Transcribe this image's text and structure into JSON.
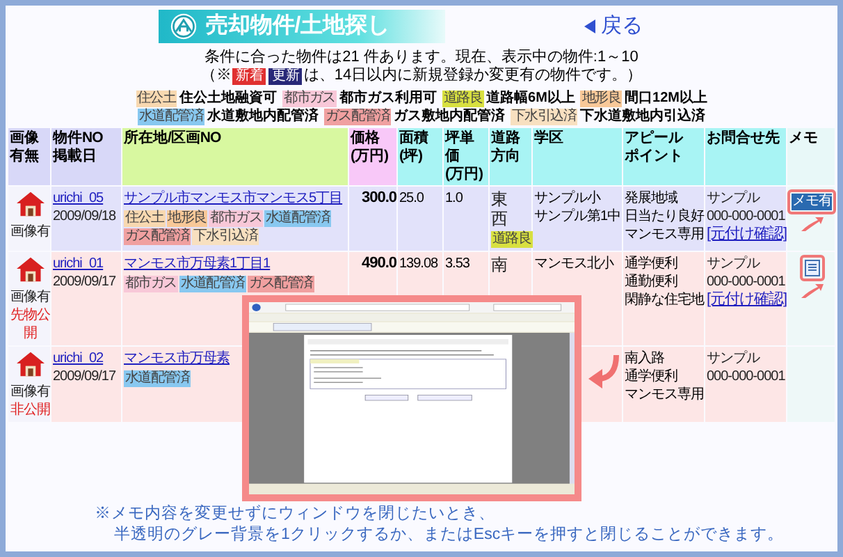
{
  "header": {
    "title": "売却物件/土地探し",
    "back_link": "戻る"
  },
  "summary": {
    "line_1": "条件に合った物件は21 件あります。現在、表示中の物件:1～10",
    "line_2_prefix": "（※",
    "badges": [
      {
        "label": "新着",
        "color": "#e03030"
      },
      {
        "label": "更新",
        "color": "#282878"
      }
    ],
    "line_2_suffix": "は、14日以内に新規登録か変更有の物件です。）"
  },
  "legend": [
    [
      {
        "tag": "住公土",
        "color": "#f8d8b0",
        "meaning": "住公土地融資可"
      },
      {
        "tag": "都市ガス",
        "color": "#f8c8d8",
        "meaning": "都市ガス利用可"
      },
      {
        "tag": "道路良",
        "color": "#d8e040",
        "meaning": "道路幅6M以上"
      },
      {
        "tag": "地形良",
        "color": "#f8c898",
        "meaning": "間口12M以上"
      }
    ],
    [
      {
        "tag": "水道配管済",
        "color": "#88c8f0",
        "meaning": "水道敷地内配管済"
      },
      {
        "tag": "ガス配管済",
        "color": "#f0a0a0",
        "meaning": "ガス敷地内配管済"
      },
      {
        "tag": "下水引込済",
        "color": "#f8e0c0",
        "meaning": "下水道敷地内引込済"
      }
    ]
  ],
  "table": {
    "columns": [
      [
        "画像",
        "有無"
      ],
      [
        "物件NO",
        "掲載日"
      ],
      [
        "所在地/区画NO"
      ],
      [
        "価格",
        "(万円)"
      ],
      [
        "面積",
        "(坪)"
      ],
      [
        "坪単価",
        "(万円)"
      ],
      [
        "道路",
        "方向"
      ],
      [
        "学区"
      ],
      [
        "アピール",
        "ポイント"
      ],
      [
        "お問合せ先"
      ],
      [
        "メモ"
      ]
    ],
    "rows": [
      {
        "image_label": "画像有",
        "id": "urichi_05",
        "date": "2009/09/18",
        "address": "サンプル市マンモス市マンモス5丁目",
        "tags": [
          {
            "label": "住公土",
            "color": "#f8d8b0"
          },
          {
            "label": "地形良",
            "color": "#f8c898"
          },
          {
            "label": "都市ガス",
            "color": "#f8c8d8"
          },
          {
            "label": "水道配管済",
            "color": "#88c8f0"
          },
          {
            "label": "ガス配管済",
            "color": "#f0a0a0"
          },
          {
            "label": "下水引込済",
            "color": "#f8e0c0"
          }
        ],
        "price": "300.0",
        "area": "25.0",
        "unit_price": "1.0",
        "road": [
          "東",
          "西"
        ],
        "road_tags": [
          {
            "label": "道路良",
            "color": "#d8e040"
          }
        ],
        "school": [
          "サンプル小",
          "サンプル第1中"
        ],
        "appeal": [
          "発展地域",
          "日当たり良好",
          "マンモス専用"
        ],
        "contact": [
          "サンプル",
          "000-000-0001"
        ],
        "contact_link": "[元付け確認]",
        "memo": {
          "kind": "badge",
          "label": "メモ有",
          "highlighted": true
        }
      },
      {
        "image_label": "画像有",
        "status": "先物公開",
        "id": "urichi_01",
        "date": "2009/09/17",
        "address": "マンモス市万母素1丁目1",
        "tags": [
          {
            "label": "都市ガス",
            "color": "#f8c8d8"
          },
          {
            "label": "水道配管済",
            "color": "#88c8f0"
          },
          {
            "label": "ガス配管済",
            "color": "#f0a0a0"
          }
        ],
        "price": "490.0",
        "area": "139.08",
        "unit_price": "3.53",
        "road": [
          "南"
        ],
        "school": [
          "マンモス北小"
        ],
        "appeal": [
          "通学便利",
          "通勤便利",
          "閑静な住宅地"
        ],
        "contact": [
          "サンプル",
          "000-000-0001"
        ],
        "contact_link": "[元付け確認]",
        "memo": {
          "kind": "icon",
          "highlighted": true
        }
      },
      {
        "image_label": "画像有",
        "status": "非公開",
        "id": "urichi_02",
        "date": "2009/09/17",
        "address": "マンモス市万母素",
        "tags": [
          {
            "label": "水道配管済",
            "color": "#88c8f0"
          }
        ],
        "appeal": [
          "南入路",
          "通学便利",
          "マンモス専用"
        ],
        "contact": [
          "サンプル",
          "000-000-0001"
        ]
      }
    ]
  },
  "note": {
    "line_1": "※メモ内容を変更せずにウィンドウを閉じたいとき、",
    "line_2": "半透明のグレー背景を1クリックするか、またはEscキーを押すと閉じることができます。"
  }
}
